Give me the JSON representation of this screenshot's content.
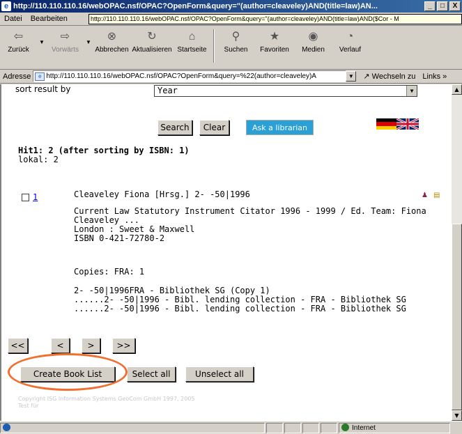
{
  "window": {
    "title": "http://110.110.110.16/webOPAC.nsf/OPAC?OpenForm&query=\"(author=cleaveley)AND(title=law)AN...",
    "buttons": [
      "_",
      "□",
      "X"
    ]
  },
  "menu": {
    "items": [
      "Datei",
      "Bearbeiten"
    ],
    "tooltip": "http://110.110.110.16/webOPAC.nsf/OPAC?OpenForm&query=\"(author=cleaveley)AND(title=law)AND($Cor - M"
  },
  "toolbar": {
    "back": "Zurück",
    "forward": "Vorwärts",
    "stop": "Abbrechen",
    "refresh": "Aktualisieren",
    "home": "Startseite",
    "search": "Suchen",
    "favorites": "Favoriten",
    "media": "Medien",
    "history": "Verlauf"
  },
  "address": {
    "label": "Adresse",
    "url": "http://110.110.110.16/webOPAC.nsf/OPAC?OpenForm&query=%22(author=cleaveley)A",
    "go": "Wechseln zu",
    "links": "Links"
  },
  "page": {
    "sort_label": "sort result by",
    "sort_value": "Year",
    "search_button": "Search",
    "clear_button": "Clear",
    "librarian_button": "Ask a librarian",
    "hits": "Hit1: 2 (after sorting by ISBN: 1)",
    "lokal": "lokal: 2",
    "record": {
      "number": "1",
      "heading": "Cleaveley Fiona [Hrsg.] 2- -50|1996",
      "title_line1": "Current Law Statutory Instrument Citator 1996 - 1999 / Ed. Team: Fiona",
      "title_line2": "Cleaveley ...",
      "publisher": "London : Sweet & Maxwell",
      "isbn": "ISBN 0-421-72780-2",
      "copies": "Copies: FRA: 1",
      "holding1": "2- -50|1996FRA - Bibliothek SG (Copy 1)",
      "holding2": "......2- -50|1996 - Bibl. lending collection - FRA - Bibliothek SG",
      "holding3": "......2- -50|1996 - Bibl. lending collection - FRA - Bibliothek SG"
    },
    "nav": [
      "<<",
      "<",
      ">",
      ">>"
    ],
    "create_book_list": "Create Book List",
    "select_all": "Select all",
    "unselect_all": "Unselect all",
    "copyright_line1": "Copyright ISG Information Systems GeoCom GmbH 1997, 2005",
    "copyright_line2": "Test für"
  },
  "status": {
    "zone": "Internet"
  },
  "colors": {
    "librarian_button": "#2aa0d6",
    "highlight_circle": "#f07030",
    "link": "#0000ee"
  }
}
